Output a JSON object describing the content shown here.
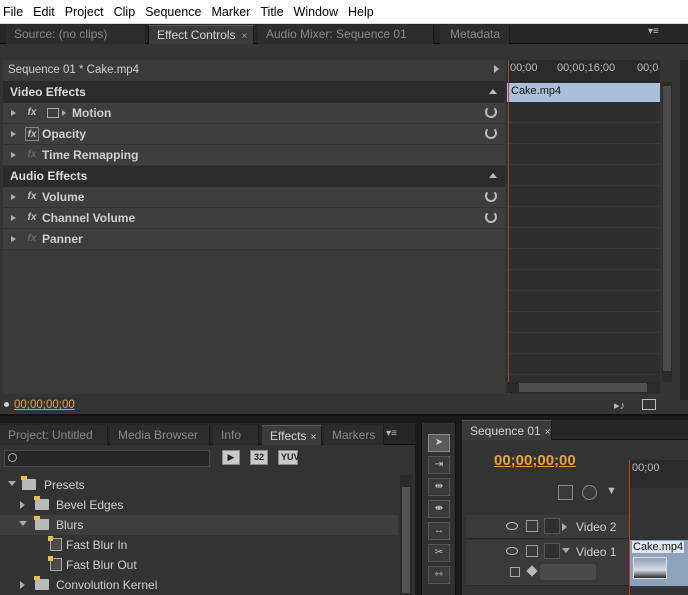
{
  "menu": [
    "File",
    "Edit",
    "Project",
    "Clip",
    "Sequence",
    "Marker",
    "Title",
    "Window",
    "Help"
  ],
  "upper_tabs": [
    {
      "label": "Source: (no clips)",
      "active": false
    },
    {
      "label": "Effect Controls",
      "active": true,
      "close": "×"
    },
    {
      "label": "Audio Mixer: Sequence 01",
      "active": false
    },
    {
      "label": "Metadata",
      "active": false
    }
  ],
  "effect_controls": {
    "sequence_label": "Sequence 01 * Cake.mp4",
    "ruler_labels": [
      "00;00",
      "00;00;16;00",
      "00;0"
    ],
    "clip_name": "Cake.mp4",
    "sections": {
      "video": "Video Effects",
      "audio": "Audio Effects"
    },
    "video_effects": [
      {
        "label": "Motion",
        "fx": "fx",
        "reset": true
      },
      {
        "label": "Opacity",
        "fx": "fx",
        "reset": true
      },
      {
        "label": "Time Remapping",
        "fx": "fx",
        "reset": false
      }
    ],
    "audio_effects": [
      {
        "label": "Volume",
        "fx": "fx",
        "reset": true
      },
      {
        "label": "Channel Volume",
        "fx": "fx",
        "reset": true
      },
      {
        "label": "Panner",
        "fx": "fx",
        "reset": false
      }
    ],
    "timecode": "00;00;00;00"
  },
  "lower_tabs": [
    {
      "label": "Project: Untitled",
      "active": false
    },
    {
      "label": "Media Browser",
      "active": false
    },
    {
      "label": "Info",
      "active": false
    },
    {
      "label": "Effects",
      "active": true,
      "close": "×"
    },
    {
      "label": "Markers",
      "active": false
    }
  ],
  "effects_panel": {
    "search_placeholder": "",
    "badges": [
      "32",
      "YUV"
    ],
    "tree": [
      {
        "label": "Presets",
        "level": 0,
        "expanded": true,
        "type": "folder"
      },
      {
        "label": "Bevel Edges",
        "level": 1,
        "expanded": false,
        "type": "folder"
      },
      {
        "label": "Blurs",
        "level": 1,
        "expanded": true,
        "type": "folder",
        "selected": true
      },
      {
        "label": "Fast Blur In",
        "level": 2,
        "type": "preset"
      },
      {
        "label": "Fast Blur Out",
        "level": 2,
        "type": "preset"
      },
      {
        "label": "Convolution Kernel",
        "level": 1,
        "expanded": false,
        "type": "folder"
      }
    ]
  },
  "sequence": {
    "tab_label": "Sequence 01",
    "close": "×",
    "timecode": "00;00;00;00",
    "ruler_label": "00;00",
    "tracks": [
      {
        "label": "Video 2",
        "expanded": false
      },
      {
        "label": "Video 1",
        "expanded": true
      }
    ],
    "clip_name": "Cake.mp4"
  },
  "colors": {
    "accent_timecode": "#e8a33c",
    "clip_blue": "#a9c0d8",
    "playhead": "#c0392b"
  }
}
